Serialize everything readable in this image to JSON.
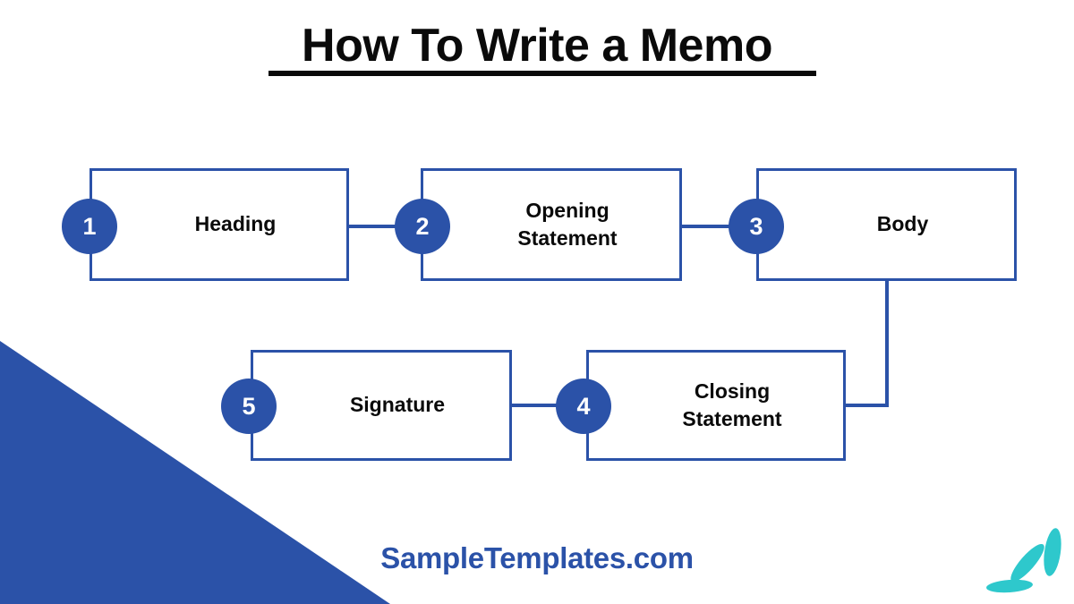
{
  "title": "How To Write a Memo",
  "brand": "SampleTemplates.com",
  "colors": {
    "primary_blue": "#2B52A8",
    "accent_teal": "#2EC8CC",
    "text_dark": "#0A0A0A",
    "background": "#FFFFFF"
  },
  "steps": [
    {
      "number": "1",
      "label": "Heading"
    },
    {
      "number": "2",
      "label": "Opening\nStatement"
    },
    {
      "number": "3",
      "label": "Body"
    },
    {
      "number": "4",
      "label": "Closing\nStatement"
    },
    {
      "number": "5",
      "label": "Signature"
    }
  ],
  "step_labels": {
    "one": "Heading",
    "two_line1": "Opening",
    "two_line2": "Statement",
    "three": "Body",
    "four_line1": "Closing",
    "four_line2": "Statement",
    "five": "Signature"
  },
  "step_numbers": {
    "one": "1",
    "two": "2",
    "three": "3",
    "four": "4",
    "five": "5"
  },
  "decorations": {
    "corner_triangle": "blue-triangle-bottom-left",
    "leaf_mark": "teal-three-leaf-mark"
  }
}
